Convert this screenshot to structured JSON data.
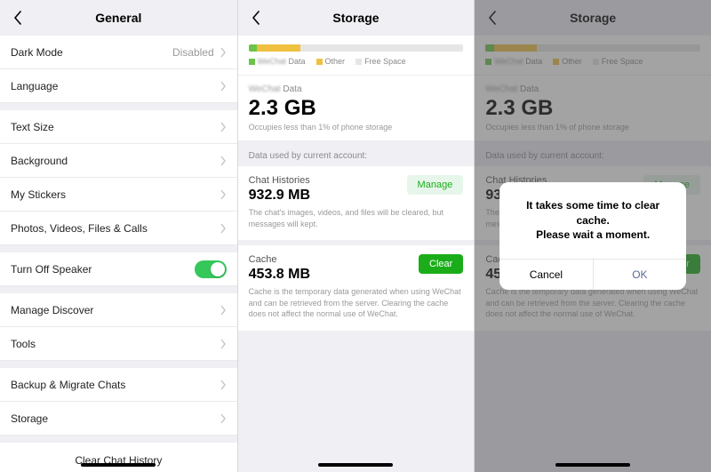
{
  "pane1": {
    "title": "General",
    "rows": [
      {
        "label": "Dark Mode",
        "value": "Disabled"
      },
      {
        "label": "Language"
      },
      {
        "label": "Text Size"
      },
      {
        "label": "Background"
      },
      {
        "label": "My Stickers"
      },
      {
        "label": "Photos, Videos, Files & Calls"
      },
      {
        "label": "Turn Off Speaker",
        "toggle": true
      },
      {
        "label": "Manage Discover"
      },
      {
        "label": "Tools"
      },
      {
        "label": "Backup & Migrate Chats"
      },
      {
        "label": "Storage"
      }
    ],
    "clear": "Clear Chat History"
  },
  "pane2": {
    "title": "Storage",
    "legend": {
      "app": "WeChat",
      "data": "Data",
      "other": "Other",
      "free": "Free Space"
    },
    "usage": {
      "app": "WeChat",
      "label_suffix": "Data",
      "value": "2.3 GB",
      "sub": "Occupies less than 1% of phone storage"
    },
    "section": "Data used by current account:",
    "chat": {
      "title": "Chat Histories",
      "value": "932.9 MB",
      "desc": "The chat's images, videos, and files will be cleared, but messages will kept.",
      "btn": "Manage"
    },
    "cache": {
      "title": "Cache",
      "value": "453.8 MB",
      "desc": "Cache is the temporary data generated when using WeChat and can be retrieved from the server. Clearing the cache does not affect the normal use of WeChat.",
      "btn": "Clear"
    },
    "bar": {
      "green": 4,
      "yellow": 20,
      "grey": 76
    }
  },
  "pane3": {
    "title": "Storage",
    "dialog": {
      "line1": "It takes some time to clear cache.",
      "line2": "Please wait a moment.",
      "cancel": "Cancel",
      "ok": "OK"
    }
  }
}
